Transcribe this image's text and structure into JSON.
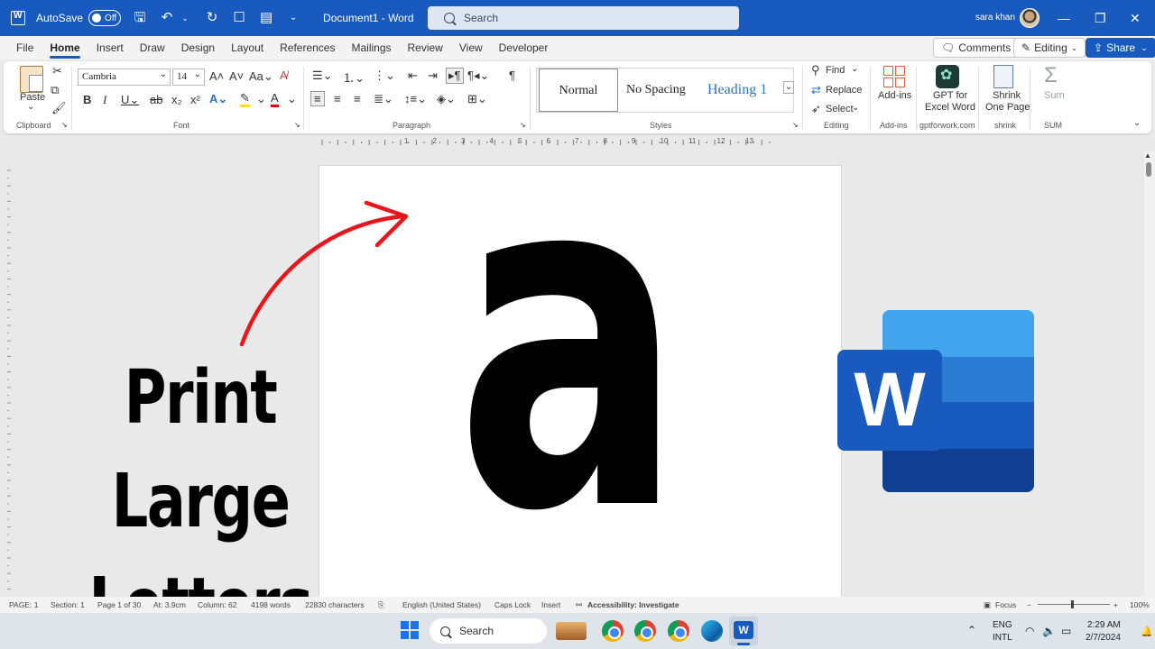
{
  "titlebar": {
    "autosave_label": "AutoSave",
    "autosave_state": "Off",
    "document_title": "Document1  -  Word",
    "search_placeholder": "Search",
    "user_name": "sara khan"
  },
  "menu": {
    "tabs": [
      "File",
      "Home",
      "Insert",
      "Draw",
      "Design",
      "Layout",
      "References",
      "Mailings",
      "Review",
      "View",
      "Developer"
    ],
    "active_tab": "Home",
    "comments_label": "Comments",
    "editing_label": "Editing",
    "share_label": "Share"
  },
  "ribbon": {
    "paste_label": "Paste",
    "clipboard_label": "Clipboard",
    "font_name": "Cambria",
    "font_size": "14",
    "font_label": "Font",
    "paragraph_label": "Paragraph",
    "styles": [
      "Normal",
      "No Spacing",
      "Heading 1"
    ],
    "styles_label": "Styles",
    "find_label": "Find",
    "replace_label": "Replace",
    "select_label": "Select",
    "editing_group_label": "Editing",
    "addins_button_label": "Add-ins",
    "addins_group_label": "Add-ins",
    "gpt_label_line1": "GPT for",
    "gpt_label_line2": "Excel Word",
    "gpt_group_label": "gptforwork.com",
    "shrink_label_line1": "Shrink",
    "shrink_label_line2": "One Page",
    "shrink_group_label": "shrink",
    "sum_label": "Sum",
    "sum_group_label": "SUM"
  },
  "ruler_numbers": [
    "1",
    "2",
    "3",
    "4",
    "5",
    "6",
    "7",
    "8",
    "9",
    "10",
    "11",
    "12",
    "13"
  ],
  "document": {
    "big_letter": "a"
  },
  "overlay": {
    "title_line1": "Print Large",
    "title_line2": "Letters",
    "arrow_color": "#e8161b"
  },
  "word_logo": {
    "letter": "W"
  },
  "statusbar": {
    "page": "PAGE: 1",
    "section": "Section: 1",
    "page_of": "Page 1 of 30",
    "at": "At: 3.9cm",
    "column": "Column: 62",
    "words": "4198 words",
    "characters": "22830 characters",
    "language": "English (United States)",
    "caps_lock": "Caps Lock",
    "insert": "Insert",
    "accessibility": "Accessibility: Investigate",
    "focus": "Focus",
    "zoom": "100%"
  },
  "taskbar": {
    "search_label": "Search",
    "lang_line1": "ENG",
    "lang_line2": "INTL",
    "time": "2:29 AM",
    "date": "2/7/2024"
  },
  "colors": {
    "titlebar": "#185abd",
    "accent": "#185abd",
    "arrow": "#e8161b"
  }
}
